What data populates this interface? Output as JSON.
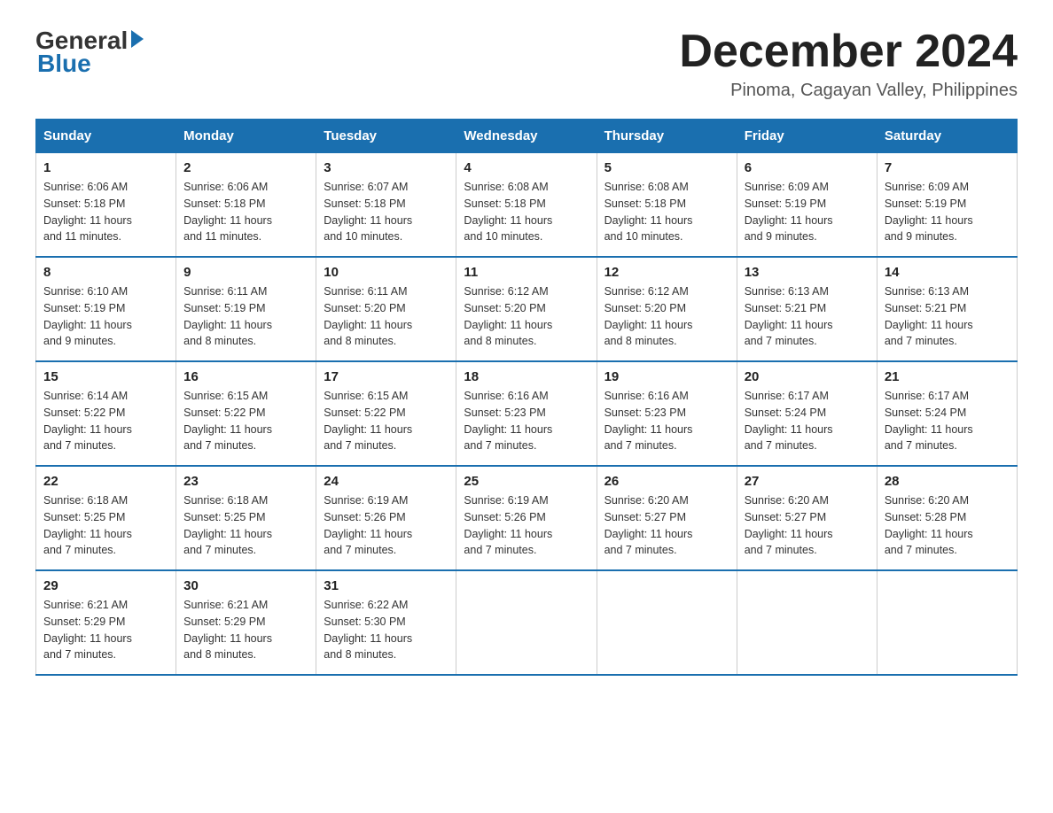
{
  "header": {
    "logo_general": "General",
    "logo_blue": "Blue",
    "month_title": "December 2024",
    "subtitle": "Pinoma, Cagayan Valley, Philippines"
  },
  "weekdays": [
    "Sunday",
    "Monday",
    "Tuesday",
    "Wednesday",
    "Thursday",
    "Friday",
    "Saturday"
  ],
  "weeks": [
    [
      {
        "day": "1",
        "sunrise": "6:06 AM",
        "sunset": "5:18 PM",
        "daylight": "11 hours and 11 minutes."
      },
      {
        "day": "2",
        "sunrise": "6:06 AM",
        "sunset": "5:18 PM",
        "daylight": "11 hours and 11 minutes."
      },
      {
        "day": "3",
        "sunrise": "6:07 AM",
        "sunset": "5:18 PM",
        "daylight": "11 hours and 10 minutes."
      },
      {
        "day": "4",
        "sunrise": "6:08 AM",
        "sunset": "5:18 PM",
        "daylight": "11 hours and 10 minutes."
      },
      {
        "day": "5",
        "sunrise": "6:08 AM",
        "sunset": "5:18 PM",
        "daylight": "11 hours and 10 minutes."
      },
      {
        "day": "6",
        "sunrise": "6:09 AM",
        "sunset": "5:19 PM",
        "daylight": "11 hours and 9 minutes."
      },
      {
        "day": "7",
        "sunrise": "6:09 AM",
        "sunset": "5:19 PM",
        "daylight": "11 hours and 9 minutes."
      }
    ],
    [
      {
        "day": "8",
        "sunrise": "6:10 AM",
        "sunset": "5:19 PM",
        "daylight": "11 hours and 9 minutes."
      },
      {
        "day": "9",
        "sunrise": "6:11 AM",
        "sunset": "5:19 PM",
        "daylight": "11 hours and 8 minutes."
      },
      {
        "day": "10",
        "sunrise": "6:11 AM",
        "sunset": "5:20 PM",
        "daylight": "11 hours and 8 minutes."
      },
      {
        "day": "11",
        "sunrise": "6:12 AM",
        "sunset": "5:20 PM",
        "daylight": "11 hours and 8 minutes."
      },
      {
        "day": "12",
        "sunrise": "6:12 AM",
        "sunset": "5:20 PM",
        "daylight": "11 hours and 8 minutes."
      },
      {
        "day": "13",
        "sunrise": "6:13 AM",
        "sunset": "5:21 PM",
        "daylight": "11 hours and 7 minutes."
      },
      {
        "day": "14",
        "sunrise": "6:13 AM",
        "sunset": "5:21 PM",
        "daylight": "11 hours and 7 minutes."
      }
    ],
    [
      {
        "day": "15",
        "sunrise": "6:14 AM",
        "sunset": "5:22 PM",
        "daylight": "11 hours and 7 minutes."
      },
      {
        "day": "16",
        "sunrise": "6:15 AM",
        "sunset": "5:22 PM",
        "daylight": "11 hours and 7 minutes."
      },
      {
        "day": "17",
        "sunrise": "6:15 AM",
        "sunset": "5:22 PM",
        "daylight": "11 hours and 7 minutes."
      },
      {
        "day": "18",
        "sunrise": "6:16 AM",
        "sunset": "5:23 PM",
        "daylight": "11 hours and 7 minutes."
      },
      {
        "day": "19",
        "sunrise": "6:16 AM",
        "sunset": "5:23 PM",
        "daylight": "11 hours and 7 minutes."
      },
      {
        "day": "20",
        "sunrise": "6:17 AM",
        "sunset": "5:24 PM",
        "daylight": "11 hours and 7 minutes."
      },
      {
        "day": "21",
        "sunrise": "6:17 AM",
        "sunset": "5:24 PM",
        "daylight": "11 hours and 7 minutes."
      }
    ],
    [
      {
        "day": "22",
        "sunrise": "6:18 AM",
        "sunset": "5:25 PM",
        "daylight": "11 hours and 7 minutes."
      },
      {
        "day": "23",
        "sunrise": "6:18 AM",
        "sunset": "5:25 PM",
        "daylight": "11 hours and 7 minutes."
      },
      {
        "day": "24",
        "sunrise": "6:19 AM",
        "sunset": "5:26 PM",
        "daylight": "11 hours and 7 minutes."
      },
      {
        "day": "25",
        "sunrise": "6:19 AM",
        "sunset": "5:26 PM",
        "daylight": "11 hours and 7 minutes."
      },
      {
        "day": "26",
        "sunrise": "6:20 AM",
        "sunset": "5:27 PM",
        "daylight": "11 hours and 7 minutes."
      },
      {
        "day": "27",
        "sunrise": "6:20 AM",
        "sunset": "5:27 PM",
        "daylight": "11 hours and 7 minutes."
      },
      {
        "day": "28",
        "sunrise": "6:20 AM",
        "sunset": "5:28 PM",
        "daylight": "11 hours and 7 minutes."
      }
    ],
    [
      {
        "day": "29",
        "sunrise": "6:21 AM",
        "sunset": "5:29 PM",
        "daylight": "11 hours and 7 minutes."
      },
      {
        "day": "30",
        "sunrise": "6:21 AM",
        "sunset": "5:29 PM",
        "daylight": "11 hours and 8 minutes."
      },
      {
        "day": "31",
        "sunrise": "6:22 AM",
        "sunset": "5:30 PM",
        "daylight": "11 hours and 8 minutes."
      },
      null,
      null,
      null,
      null
    ]
  ],
  "labels": {
    "sunrise": "Sunrise:",
    "sunset": "Sunset:",
    "daylight": "Daylight:"
  }
}
